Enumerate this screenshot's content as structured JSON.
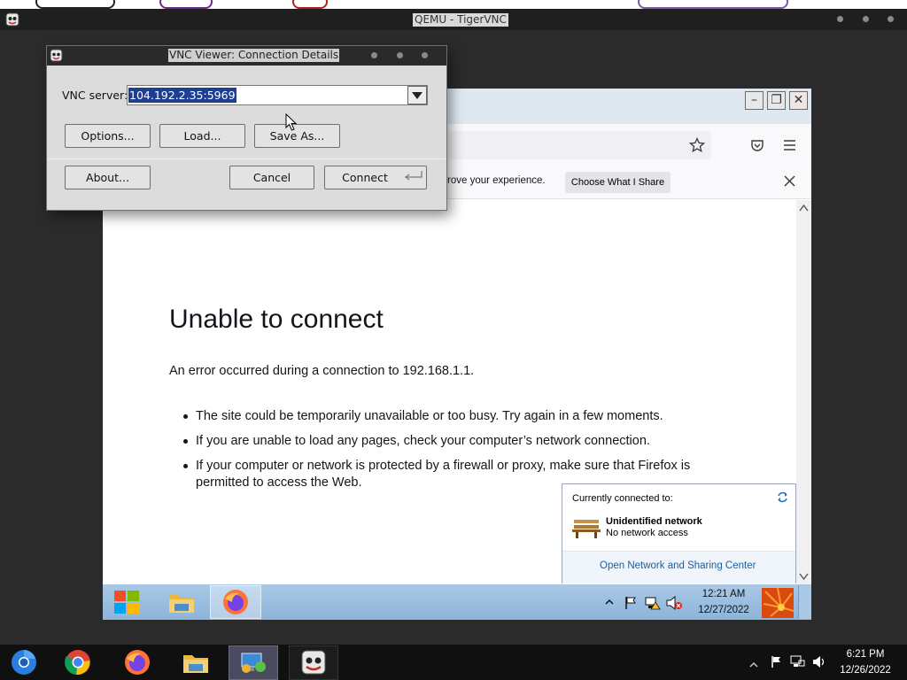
{
  "host_window": {
    "title": "QEMU - TigerVNC"
  },
  "vnc_dialog": {
    "title": "VNC Viewer: Connection Details",
    "server_label": "VNC server:",
    "server_value": "104.192.2.35:5969",
    "buttons": {
      "options": "Options...",
      "load": "Load...",
      "save_as": "Save As...",
      "about": "About...",
      "cancel": "Cancel",
      "connect": "Connect"
    }
  },
  "browser": {
    "notification": {
      "text": "rove your experience.",
      "button": "Choose What I Share"
    },
    "error_page": {
      "title": "Unable to connect",
      "description": "An error occurred during a connection to 192.168.1.1.",
      "bullets": [
        "The site could be temporarily unavailable or too busy. Try again in a few moments.",
        "If you are unable to load any pages, check your computer’s network connection.",
        "If your computer or network is protected by a firewall or proxy, make sure that Firefox is permitted to access the Web."
      ]
    }
  },
  "network_popup": {
    "heading": "Currently connected to:",
    "network_name": "Unidentified network",
    "network_status": "No network access",
    "link": "Open Network and Sharing Center"
  },
  "guest_taskbar": {
    "time": "12:21 AM",
    "date": "12/27/2022"
  },
  "host_taskbar": {
    "time": "6:21 PM",
    "date": "12/26/2022"
  },
  "colors": {
    "selection": "#1e3f8f",
    "link": "#1c5d9c",
    "guest_taskbar": "#a9c8e6",
    "host_taskbar": "#101010"
  }
}
